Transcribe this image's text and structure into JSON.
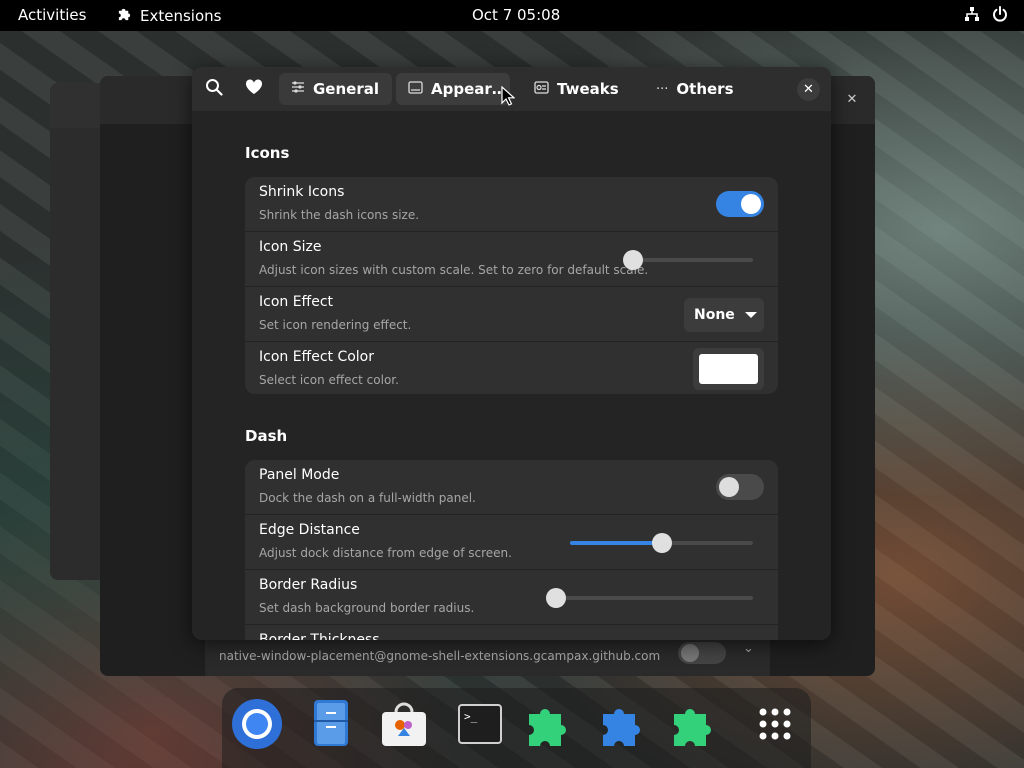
{
  "topbar": {
    "activities": "Activities",
    "app_name": "Extensions",
    "clock": "Oct 7  05:08"
  },
  "background_window": {
    "extension_id": "native-window-placement@gnome-shell-extensions.gcampax.github.com"
  },
  "prefs": {
    "tabs": [
      {
        "label": "General",
        "icon": "sliders-icon"
      },
      {
        "label": "Appear…",
        "icon": "appearance-icon"
      },
      {
        "label": "Tweaks",
        "icon": "tweaks-icon"
      },
      {
        "label": "Others",
        "icon": "more-icon"
      }
    ],
    "sections": {
      "icons": {
        "title": "Icons",
        "rows": [
          {
            "title": "Shrink Icons",
            "subtitle": "Shrink the dash icons size.",
            "control": "toggle",
            "value": true
          },
          {
            "title": "Icon Size",
            "subtitle": "Adjust icon sizes with custom scale. Set to zero for default scale.",
            "control": "slider",
            "value": 0
          },
          {
            "title": "Icon Effect",
            "subtitle": "Set icon rendering effect.",
            "control": "dropdown",
            "value": "None"
          },
          {
            "title": "Icon Effect Color",
            "subtitle": "Select icon effect color.",
            "control": "color",
            "value": "#ffffff"
          }
        ]
      },
      "dash": {
        "title": "Dash",
        "rows": [
          {
            "title": "Panel Mode",
            "subtitle": "Dock the dash on a full-width panel.",
            "control": "toggle",
            "value": false
          },
          {
            "title": "Edge Distance",
            "subtitle": "Adjust dock distance from edge of screen.",
            "control": "slider",
            "value": 0.5
          },
          {
            "title": "Border Radius",
            "subtitle": "Set dash background border radius.",
            "control": "slider",
            "value": 0
          },
          {
            "title": "Border Thickness",
            "subtitle": "",
            "control": "none"
          }
        ]
      }
    }
  },
  "dock": {
    "apps": [
      "chromium-browser-icon",
      "files-icon",
      "software-store-icon",
      "terminal-icon",
      "extension-puzzle-icon",
      "extension-manager-icon",
      "extension-puzzle-icon",
      "app-grid-icon"
    ]
  },
  "colors": {
    "accent": "#3584e4",
    "window_bg": "#242424",
    "row_bg": "#303030",
    "header_bg": "#2e2e2e",
    "extension_green": "#33d17a"
  }
}
